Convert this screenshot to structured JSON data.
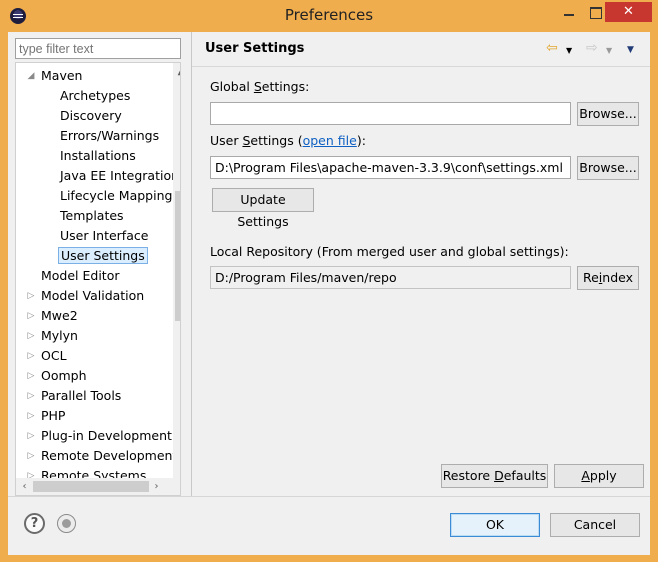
{
  "window": {
    "title": "Preferences",
    "close_glyph": "✕"
  },
  "filter": {
    "placeholder": "type filter text"
  },
  "tree": {
    "items": [
      {
        "label": "Maven",
        "arrow": "◢",
        "level": 0
      },
      {
        "label": "Archetypes",
        "level": 1
      },
      {
        "label": "Discovery",
        "level": 1
      },
      {
        "label": "Errors/Warnings",
        "level": 1
      },
      {
        "label": "Installations",
        "level": 1
      },
      {
        "label": "Java EE Integration",
        "level": 1
      },
      {
        "label": "Lifecycle Mappings",
        "level": 1
      },
      {
        "label": "Templates",
        "level": 1
      },
      {
        "label": "User Interface",
        "level": 1
      },
      {
        "label": "User Settings",
        "level": 1,
        "selected": true
      },
      {
        "label": "Model Editor",
        "level": 0
      },
      {
        "label": "Model Validation",
        "arrow": "▷",
        "level": 0
      },
      {
        "label": "Mwe2",
        "arrow": "▷",
        "level": 0
      },
      {
        "label": "Mylyn",
        "arrow": "▷",
        "level": 0
      },
      {
        "label": "OCL",
        "arrow": "▷",
        "level": 0
      },
      {
        "label": "Oomph",
        "arrow": "▷",
        "level": 0
      },
      {
        "label": "Parallel Tools",
        "arrow": "▷",
        "level": 0
      },
      {
        "label": "PHP",
        "arrow": "▷",
        "level": 0
      },
      {
        "label": "Plug-in Development",
        "arrow": "▷",
        "level": 0
      },
      {
        "label": "Remote Development",
        "arrow": "▷",
        "level": 0
      },
      {
        "label": "Remote Systems",
        "arrow": "▷",
        "level": 0
      }
    ]
  },
  "page": {
    "title": "User Settings",
    "global_settings_label_pre": "Global ",
    "global_settings_label_u": "S",
    "global_settings_label_post": "ettings:",
    "global_settings_value": "",
    "user_settings_label_pre": "User ",
    "user_settings_label_u": "S",
    "user_settings_label_mid": "ettings (",
    "user_settings_link": "open file",
    "user_settings_label_post": "):",
    "user_settings_value": "D:\\Program Files\\apache-maven-3.3.9\\conf\\settings.xml",
    "browse_label": "Browse...",
    "update_settings_label": "Update Settings",
    "local_repo_label": "Local Repository (From merged user and global settings):",
    "local_repo_value": "D:/Program Files/maven/repo",
    "reindex_pre": "Re",
    "reindex_u": "i",
    "reindex_post": "ndex",
    "restore_pre": "Restore ",
    "restore_u": "D",
    "restore_post": "efaults",
    "apply_u": "A",
    "apply_post": "pply"
  },
  "footer": {
    "ok_label": "OK",
    "cancel_label": "Cancel",
    "help_glyph": "?"
  },
  "icons": {
    "back": "⇦",
    "forward": "⇨",
    "dropdown": "▼",
    "scroll_up": "▲",
    "scroll_down": "▼",
    "scroll_left": "‹",
    "scroll_right": "›"
  },
  "colors": {
    "title_bar": "#f0ad4e",
    "close_button": "#c7372f",
    "link": "#0e60c2",
    "selection": "#dbeeff"
  }
}
